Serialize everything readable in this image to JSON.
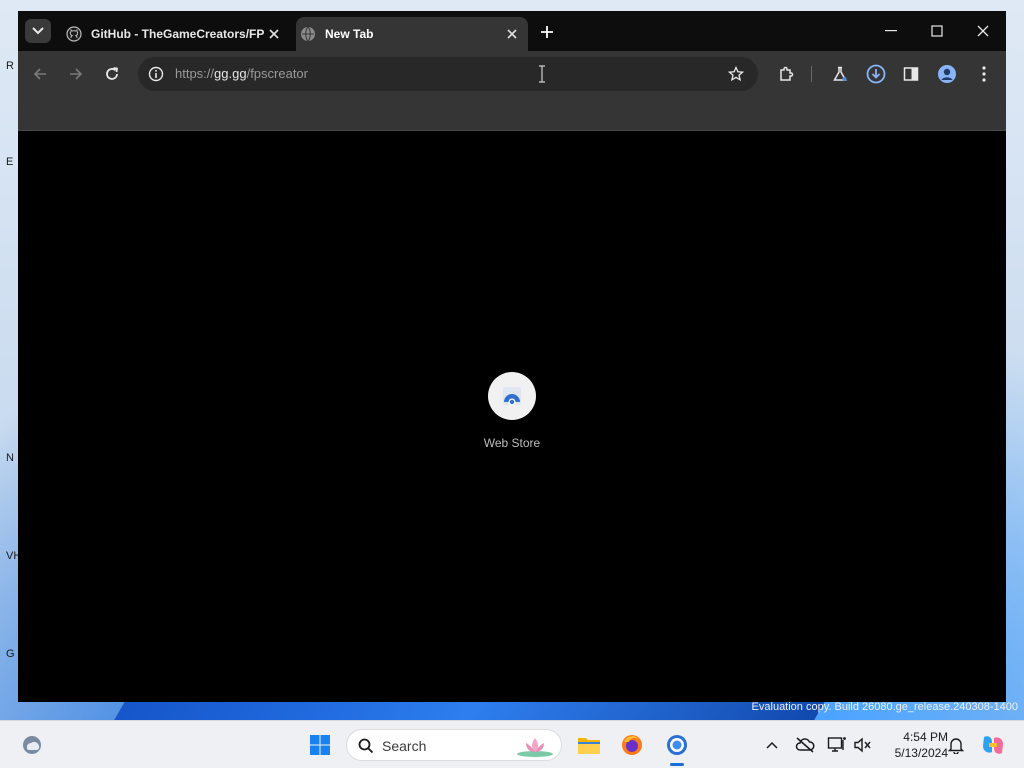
{
  "browser": {
    "tabs": [
      {
        "title": "GitHub - TheGameCreators/FP",
        "icon": "github-icon",
        "active": false
      },
      {
        "title": "New Tab",
        "icon": "globe-icon",
        "active": true
      }
    ],
    "address": {
      "scheme": "https://",
      "host": "gg.gg",
      "path": "/fpscreator"
    },
    "new_tab_page": {
      "shortcuts": [
        {
          "label": "Web Store",
          "icon": "web-store-icon"
        }
      ]
    }
  },
  "taskbar": {
    "search_label": "Search",
    "time": "4:54 PM",
    "date": "5/13/2024"
  },
  "desktop": {
    "watermark": "Evaluation copy. Build 26080.ge_release.240308-1400",
    "icon_letters": [
      "R",
      "E",
      "N",
      "VH",
      "G"
    ]
  },
  "colors": {
    "accent": "#1a6fd8",
    "tab_active_bg": "#353535",
    "content_bg": "#000000"
  }
}
